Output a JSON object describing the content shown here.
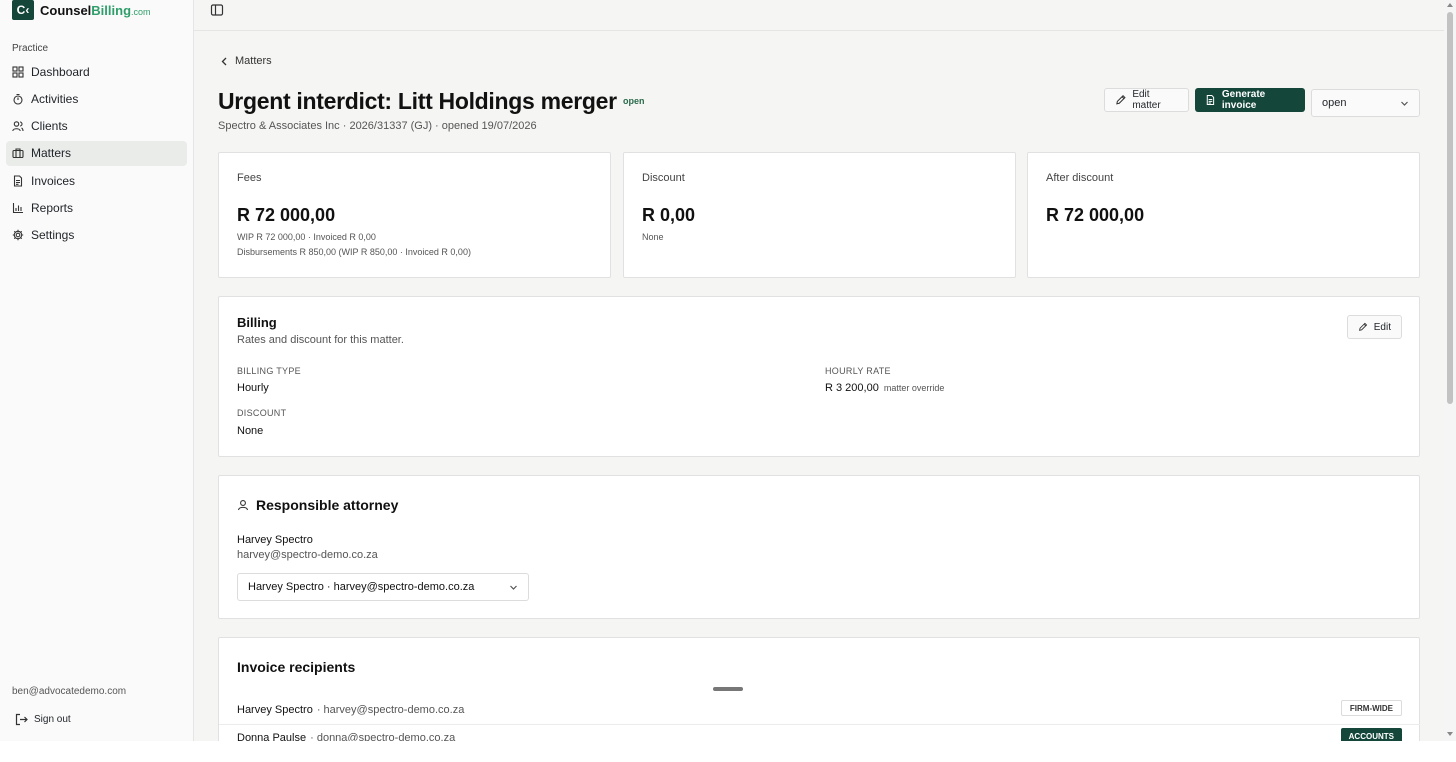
{
  "brand": {
    "mark": "C",
    "name_part1": "Counsel",
    "name_part2": "Billing",
    "domain": ".com"
  },
  "sidebar": {
    "section": "Practice",
    "items": [
      {
        "label": "Dashboard",
        "icon": "grid-icon"
      },
      {
        "label": "Activities",
        "icon": "timer-icon"
      },
      {
        "label": "Clients",
        "icon": "users-icon"
      },
      {
        "label": "Matters",
        "icon": "briefcase-icon",
        "active": true
      },
      {
        "label": "Invoices",
        "icon": "file-icon"
      },
      {
        "label": "Reports",
        "icon": "bar-chart-icon"
      },
      {
        "label": "Settings",
        "icon": "gear-icon"
      }
    ],
    "user_email": "ben@advocatedemo.com",
    "signout_label": "Sign out"
  },
  "breadcrumb": {
    "label": "Matters"
  },
  "matter": {
    "title": "Urgent interdict: Litt Holdings merger",
    "status_badge": "open",
    "subtitle": "Spectro & Associates Inc · 2026/31337 (GJ) · opened 19/07/2026"
  },
  "actions": {
    "edit_matter": "Edit matter",
    "generate_invoice": "Generate invoice",
    "status_value": "open"
  },
  "metrics": {
    "fees": {
      "label": "Fees",
      "value": "R 72 000,00",
      "line1": "WIP R 72 000,00 · Invoiced R 0,00",
      "line2": "Disbursements R 850,00 (WIP R 850,00 · Invoiced R 0,00)"
    },
    "discount": {
      "label": "Discount",
      "value": "R 0,00",
      "line1": "None"
    },
    "after_discount": {
      "label": "After discount",
      "value": "R 72 000,00"
    }
  },
  "billing": {
    "title": "Billing",
    "description": "Rates and discount for this matter.",
    "edit_label": "Edit",
    "billing_type_label": "BILLING TYPE",
    "billing_type_value": "Hourly",
    "hourly_rate_label": "HOURLY RATE",
    "hourly_rate_value": "R 3 200,00",
    "hourly_rate_note": "matter override",
    "discount_label": "DISCOUNT",
    "discount_value": "None"
  },
  "attorney": {
    "title": "Responsible attorney",
    "name": "Harvey Spectro",
    "email": "harvey@spectro-demo.co.za",
    "select_value": "Harvey Spectro · harvey@spectro-demo.co.za"
  },
  "recipients": {
    "title": "Invoice recipients",
    "rows": [
      {
        "name": "Harvey Spectro",
        "email": "· harvey@spectro-demo.co.za",
        "tag": "FIRM-WIDE"
      },
      {
        "name": "Donna Paulse",
        "email": "· donna@spectro-demo.co.za",
        "tag": "ACCOUNTS"
      }
    ]
  },
  "colors": {
    "brand": "#14463a",
    "accent": "#2f9e6a"
  }
}
